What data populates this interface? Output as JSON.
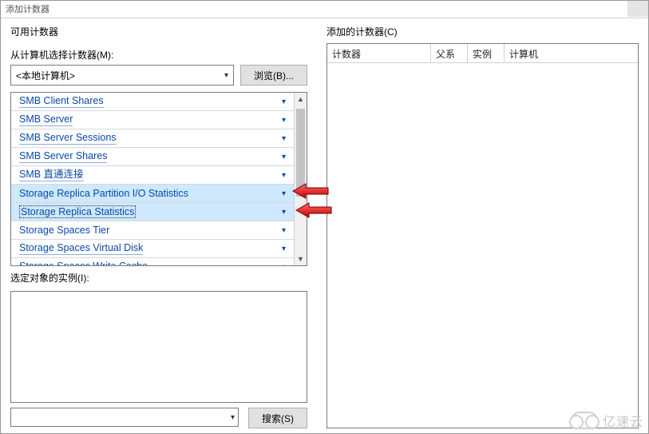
{
  "window": {
    "title": "添加计数器"
  },
  "left": {
    "group_label": "可用计数器",
    "computer_label": "从计算机选择计数器(M):",
    "computer_value": "<本地计算机>",
    "browse_label": "浏览(B)...",
    "counters": [
      {
        "label": "SMB Client Shares",
        "underlined": true
      },
      {
        "label": "SMB Server",
        "underlined": true
      },
      {
        "label": "SMB Server Sessions",
        "underlined": true
      },
      {
        "label": "SMB Server Shares",
        "underlined": true
      },
      {
        "label": "SMB 直通连接",
        "underlined": true
      },
      {
        "label": "Storage Replica Partition I/O Statistics",
        "highlight": true
      },
      {
        "label": "Storage Replica Statistics",
        "highlight": true,
        "selected": true
      },
      {
        "label": "Storage Spaces Tier"
      },
      {
        "label": "Storage Spaces Virtual Disk",
        "underlined": true
      },
      {
        "label": "Storage Spaces Write Cache",
        "underlined": true
      }
    ],
    "instances_label": "选定对象的实例(I):",
    "search_label": "搜索(S)"
  },
  "right": {
    "group_label": "添加的计数器(C)",
    "columns": {
      "counter": "计数器",
      "parent": "父系",
      "instance": "实例",
      "computer": "计算机"
    }
  },
  "watermark": "亿速云"
}
